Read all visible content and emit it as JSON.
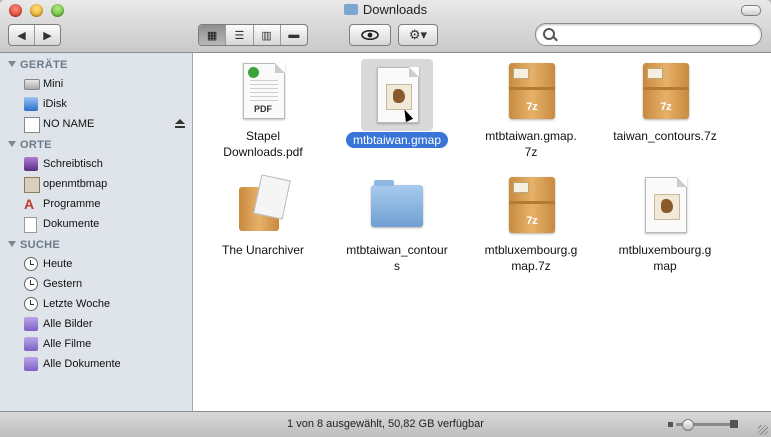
{
  "window": {
    "title": "Downloads"
  },
  "toolbar": {
    "back_label": "◀",
    "forward_label": "▶",
    "view_icon": "▦",
    "view_list": "☰",
    "view_columns": "▥",
    "view_coverflow": "▬",
    "action_label": "⚙▾",
    "search_placeholder": ""
  },
  "sidebar": {
    "sections": [
      {
        "title": "GERÄTE",
        "items": [
          {
            "label": "Mini",
            "icon": "hard-disk-icon"
          },
          {
            "label": "iDisk",
            "icon": "idisk-icon"
          },
          {
            "label": "NO NAME",
            "icon": "external-disk-icon",
            "eject": true
          }
        ]
      },
      {
        "title": "ORTE",
        "items": [
          {
            "label": "Schreibtisch",
            "icon": "desktop-icon"
          },
          {
            "label": "openmtbmap",
            "icon": "home-icon"
          },
          {
            "label": "Programme",
            "icon": "applications-icon"
          },
          {
            "label": "Dokumente",
            "icon": "documents-icon"
          }
        ]
      },
      {
        "title": "SUCHE",
        "items": [
          {
            "label": "Heute",
            "icon": "clock-icon"
          },
          {
            "label": "Gestern",
            "icon": "clock-icon"
          },
          {
            "label": "Letzte Woche",
            "icon": "clock-icon"
          },
          {
            "label": "Alle Bilder",
            "icon": "smart-folder-icon"
          },
          {
            "label": "Alle Filme",
            "icon": "smart-folder-icon"
          },
          {
            "label": "Alle Dokumente",
            "icon": "smart-folder-icon"
          }
        ]
      }
    ]
  },
  "files": [
    {
      "name_lines": [
        "Stapel",
        "Downloads.pdf"
      ],
      "kind": "pdf-document-icon",
      "selected": false
    },
    {
      "name_lines": [
        "mtbtaiwan.gmap"
      ],
      "kind": "gmap-document-icon",
      "selected": true
    },
    {
      "name_lines": [
        "mtbtaiwan.gmap.",
        "7z"
      ],
      "kind": "7z-archive-icon",
      "selected": false
    },
    {
      "name_lines": [
        "taiwan_contours.7z"
      ],
      "kind": "7z-archive-icon",
      "selected": false
    },
    {
      "name_lines": [
        "The Unarchiver"
      ],
      "kind": "unarchiver-app-icon",
      "selected": false
    },
    {
      "name_lines": [
        "mtbtaiwan_contour",
        "s"
      ],
      "kind": "folder-icon",
      "selected": false
    },
    {
      "name_lines": [
        "mtbluxembourg.g",
        "map.7z"
      ],
      "kind": "7z-archive-icon",
      "selected": false
    },
    {
      "name_lines": [
        "mtbluxembourg.g",
        "map"
      ],
      "kind": "gmap-document-icon",
      "selected": false
    }
  ],
  "archive_badge": "7z",
  "pdf_badge": "PDF",
  "status": {
    "text": "1 von 8 ausgewählt, 50,82 GB verfügbar"
  }
}
